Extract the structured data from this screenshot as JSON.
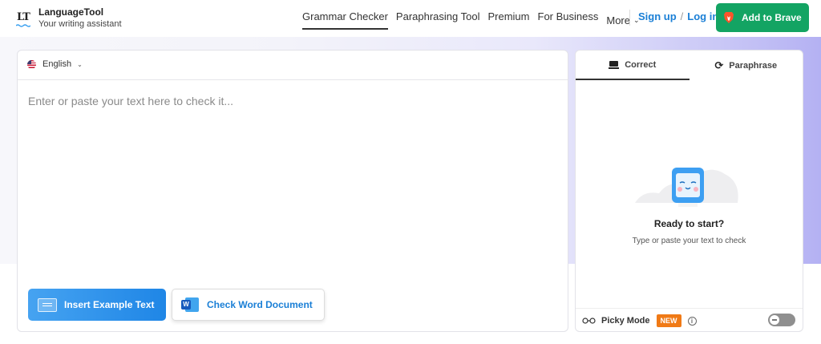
{
  "brand": {
    "name": "LanguageTool",
    "tagline": "Your writing assistant",
    "logo_letters": "LT"
  },
  "nav": {
    "items": [
      {
        "label": "Grammar Checker",
        "active": true
      },
      {
        "label": "Paraphrasing Tool"
      },
      {
        "label": "Premium"
      },
      {
        "label": "For Business"
      }
    ],
    "more_label": "More"
  },
  "auth": {
    "signup": "Sign up",
    "separator": "/",
    "login": "Log in"
  },
  "brave_button": {
    "label": "Add to Brave",
    "color": "#13a463"
  },
  "editor": {
    "language": "English",
    "placeholder": "Enter or paste your text here to check it...",
    "example_button": "Insert Example Text",
    "word_button": "Check Word Document",
    "word_icon_letter": "W"
  },
  "panel": {
    "tabs": [
      {
        "label": "Correct",
        "icon": "laptop-icon",
        "active": true
      },
      {
        "label": "Paraphrase",
        "icon": "paraphrase-icon"
      }
    ],
    "ready_title": "Ready to start?",
    "ready_hint": "Type or paste your text to check",
    "picky_label": "Picky Mode",
    "new_badge": "NEW",
    "picky_enabled": false
  },
  "colors": {
    "link_blue": "#1a7fd6",
    "new_badge": "#f07a16"
  }
}
